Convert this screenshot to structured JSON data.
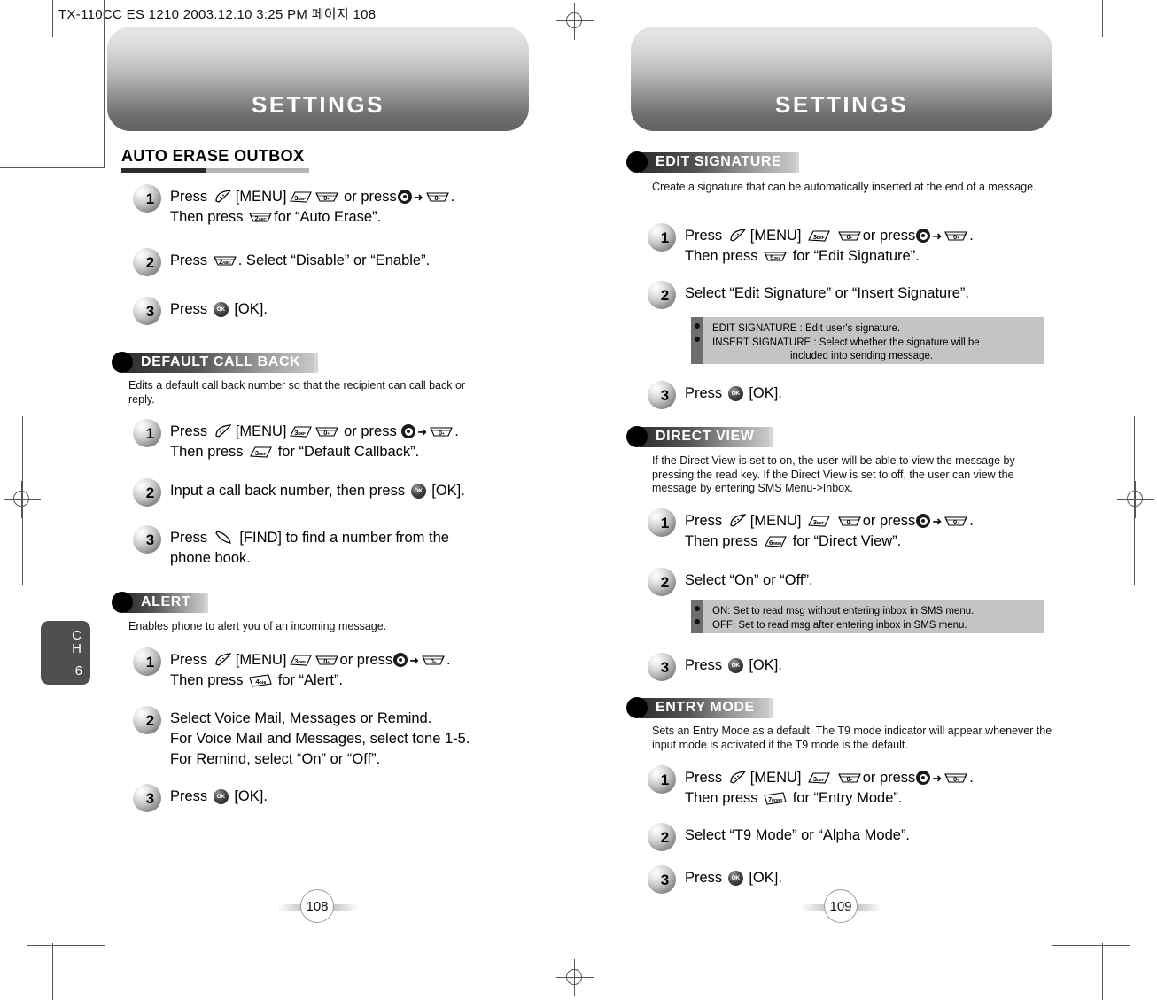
{
  "slug": "TX-110CC ES 1210  2003.12.10 3:25 PM 페이지 108",
  "left_page": {
    "banner_title": "SETTINGS",
    "chapter_tab": {
      "ch": "CH",
      "number": "6"
    },
    "folio": "108",
    "sections": [
      {
        "id": "auto-erase-outbox",
        "style": "plain",
        "title": "AUTO ERASE OUTBOX",
        "desc": "",
        "steps": [
          {
            "num": "1",
            "lines": [
              "Press [softkey] [MENU][key:3][key:0] or press[nav][arrow][key:0].",
              "Then press [key:2] for “Auto Erase”."
            ]
          },
          {
            "num": "2",
            "lines": [
              "Press [key:2]. Select “Disable” or “Enable”."
            ]
          },
          {
            "num": "3",
            "lines": [
              "Press [ok] [OK]."
            ]
          }
        ]
      },
      {
        "id": "default-call-back",
        "style": "pill",
        "title": "DEFAULT CALL BACK",
        "desc": "Edits a default call back number so that the recipient can call back or reply.",
        "steps": [
          {
            "num": "1",
            "lines": [
              "Press [softkey] [MENU][key:3][key:0] or press [nav][arrow][key:0].",
              "Then press [key:3] for “Default Callback”."
            ]
          },
          {
            "num": "2",
            "lines": [
              "Input a call back number, then press [ok] [OK]."
            ]
          },
          {
            "num": "3",
            "lines": [
              "Press [findkey] [FIND] to find a number from the",
              "phone book."
            ]
          }
        ]
      },
      {
        "id": "alert",
        "style": "pill",
        "title": "ALERT",
        "desc": "Enables phone to alert you of an incoming message.",
        "steps": [
          {
            "num": "1",
            "lines": [
              "Press [softkey] [MENU][key:3][key:0] or press[nav][arrow][key:0].",
              "Then press [key:4] for “Alert”."
            ]
          },
          {
            "num": "2",
            "lines": [
              "Select Voice Mail, Messages or Remind.",
              "For Voice Mail and Messages, select tone 1-5.",
              "For Remind, select “On” or “Off”."
            ]
          },
          {
            "num": "3",
            "lines": [
              "Press [ok] [OK]."
            ]
          }
        ]
      }
    ]
  },
  "right_page": {
    "banner_title": "SETTINGS",
    "chapter_tab": {
      "ch": "CH",
      "number": "6"
    },
    "folio": "109",
    "sections": [
      {
        "id": "edit-signature",
        "style": "pill",
        "title": "EDIT SIGNATURE",
        "desc": "Create a signature that can be automatically inserted at the end of a message.",
        "steps": [
          {
            "num": "1",
            "lines": [
              "Press [softkey] [MENU] [key:3] [key:0]or press[nav][arrow][key:0].",
              "Then press [key:5] for “Edit Signature”."
            ]
          },
          {
            "num": "2",
            "lines": [
              "Select “Edit Signature” or “Insert Signature”."
            ]
          },
          {
            "num": "3",
            "lines": [
              "Press [ok] [OK]."
            ]
          }
        ],
        "notebox": {
          "bullets": 2,
          "lines": [
            {
              "text": "EDIT SIGNATURE : Edit user's signature.",
              "indent": false
            },
            {
              "text": "INSERT SIGNATURE : Select whether the signature will be",
              "indent": false
            },
            {
              "text": "included into sending message.",
              "indent": true
            }
          ]
        }
      },
      {
        "id": "direct-view",
        "style": "pill",
        "title": "DIRECT VIEW",
        "desc": "If the Direct View is set to on, the user will be able to view the message by pressing the read key. If the Direct View is set to off, the user can view the message by entering SMS Menu->Inbox.",
        "steps": [
          {
            "num": "1",
            "lines": [
              "Press [softkey] [MENU] [key:3] [key:0]or press[nav][arrow][key:0].",
              "Then press [key:6] for “Direct View”."
            ]
          },
          {
            "num": "2",
            "lines": [
              "Select “On” or “Off”."
            ]
          },
          {
            "num": "3",
            "lines": [
              "Press [ok] [OK]."
            ]
          }
        ],
        "notebox": {
          "bullets": 2,
          "lines": [
            {
              "text": "ON: Set to read msg without entering inbox in SMS menu.",
              "indent": false
            },
            {
              "text": "OFF: Set to read msg after entering inbox in SMS menu.",
              "indent": false
            }
          ]
        }
      },
      {
        "id": "entry-mode",
        "style": "pill",
        "title": "ENTRY MODE",
        "desc": "Sets an Entry Mode as a default. The T9 mode indicator will appear whenever the input mode is activated if the T9 mode is the default.",
        "steps": [
          {
            "num": "1",
            "lines": [
              "Press [softkey] [MENU] [key:3] [key:0]or press[nav][arrow][key:0].",
              "Then press [key:7] for “Entry Mode”."
            ]
          },
          {
            "num": "2",
            "lines": [
              "Select “T9 Mode” or “Alpha Mode”."
            ]
          },
          {
            "num": "3",
            "lines": [
              "Press [ok] [OK]."
            ]
          }
        ]
      }
    ]
  },
  "key_glyphs": {
    "0": "0<sub>+</sub>",
    "2": "2<sub>ABC</sub>",
    "3": "3<sub>DEF</sub>",
    "4": "4<sub>GHI</sub>",
    "5": "5<sub>JKL</sub>",
    "6": "6<sub>MNO</sub>",
    "7": "7<sub>PQRS</sub>"
  },
  "ok_label": "OK",
  "colors": {
    "banner_dark": "#636363",
    "banner_light": "#e6e6e6",
    "section_bar_dark": "#2e2e2e",
    "section_bar_light": "#c9c9c9",
    "note_strip": "#6e6e6e",
    "note_body": "#c4c4c4",
    "chapter_tab": "#4f4f4f",
    "heading_rule_dark": "#2b2b2b",
    "heading_rule_light": "#b4b4b4"
  }
}
